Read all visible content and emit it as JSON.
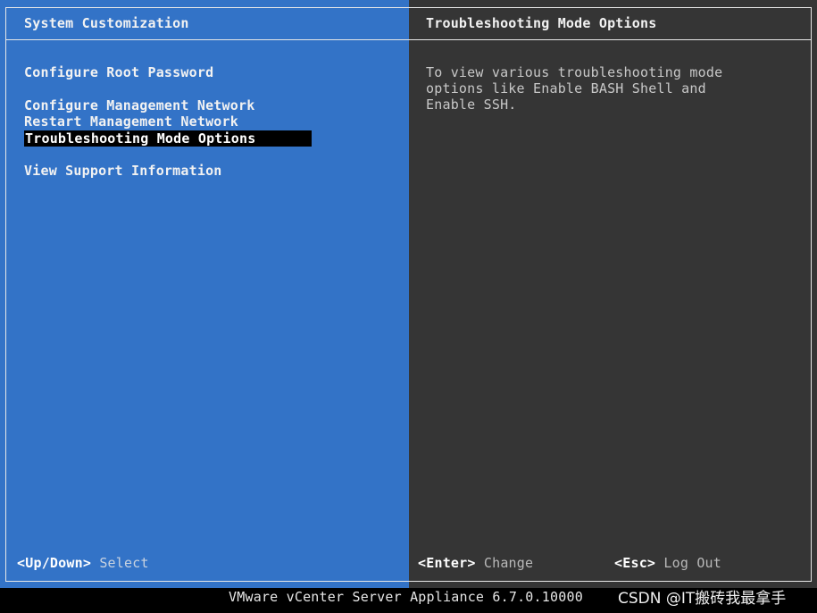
{
  "left_panel": {
    "title": "System Customization",
    "menu": [
      {
        "label": "Configure Root Password"
      },
      {
        "label": "Configure Management Network"
      },
      {
        "label": "Restart Management Network"
      },
      {
        "label": "Troubleshooting Mode Options",
        "selected": true
      },
      {
        "label": "View Support Information"
      }
    ]
  },
  "right_panel": {
    "title": "Troubleshooting Mode Options",
    "description_lines": [
      "To view various troubleshooting mode",
      "options like Enable BASH Shell and",
      "Enable SSH."
    ]
  },
  "hints": {
    "updown_key": "<Up/Down>",
    "updown_action": "Select",
    "enter_key": "<Enter>",
    "enter_action": "Change",
    "esc_key": "<Esc>",
    "esc_action": "Log Out"
  },
  "footer": {
    "product": "VMware vCenter Server Appliance 6.7.0.10000",
    "watermark": "CSDN @IT搬砖我最拿手"
  },
  "colors": {
    "left_bg": "#3373c7",
    "right_bg": "#353535",
    "selection_bg": "#000000"
  }
}
